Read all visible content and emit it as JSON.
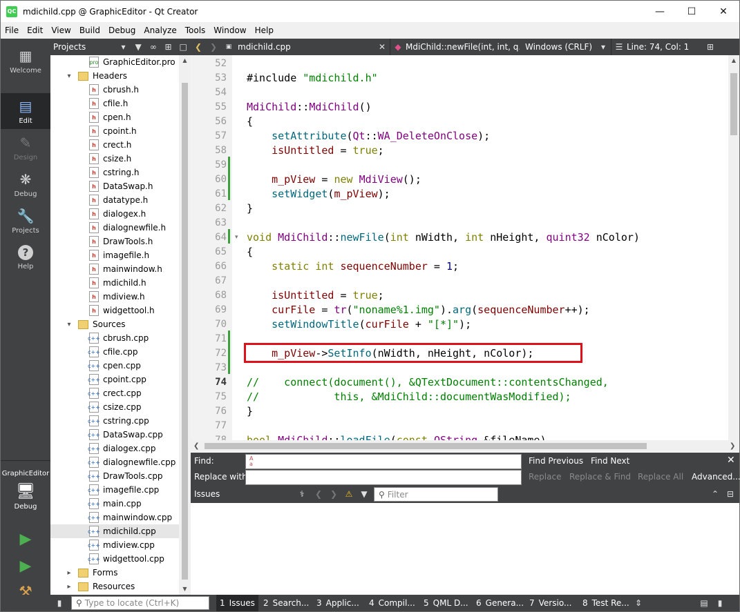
{
  "window": {
    "title": "mdichild.cpp @ GraphicEditor - Qt Creator",
    "app_icon_text": "QC",
    "controls": [
      "minimize-icon",
      "maximize-icon",
      "close-icon"
    ]
  },
  "menu": [
    "File",
    "Edit",
    "View",
    "Build",
    "Debug",
    "Analyze",
    "Tools",
    "Window",
    "Help"
  ],
  "modes": [
    {
      "label": "Welcome",
      "icon": "grid-icon"
    },
    {
      "label": "Edit",
      "icon": "document-icon",
      "active": true
    },
    {
      "label": "Design",
      "icon": "pencil-icon",
      "disabled": true
    },
    {
      "label": "Debug",
      "icon": "bug-icon"
    },
    {
      "label": "Projects",
      "icon": "wrench-icon"
    },
    {
      "label": "Help",
      "icon": "help-icon"
    }
  ],
  "kit": {
    "project": "GraphicEditor",
    "config": "Debug"
  },
  "projects_panel": {
    "title": "Projects"
  },
  "tree": [
    {
      "label": "GraphicEditor.pro",
      "type": "pro",
      "level": 2
    },
    {
      "label": "Headers",
      "type": "folder",
      "level": 1,
      "expanded": true
    },
    {
      "label": "cbrush.h",
      "type": "h",
      "level": 2
    },
    {
      "label": "cfile.h",
      "type": "h",
      "level": 2
    },
    {
      "label": "cpen.h",
      "type": "h",
      "level": 2
    },
    {
      "label": "cpoint.h",
      "type": "h",
      "level": 2
    },
    {
      "label": "crect.h",
      "type": "h",
      "level": 2
    },
    {
      "label": "csize.h",
      "type": "h",
      "level": 2
    },
    {
      "label": "cstring.h",
      "type": "h",
      "level": 2
    },
    {
      "label": "DataSwap.h",
      "type": "h",
      "level": 2
    },
    {
      "label": "datatype.h",
      "type": "h",
      "level": 2
    },
    {
      "label": "dialogex.h",
      "type": "h",
      "level": 2
    },
    {
      "label": "dialognewfile.h",
      "type": "h",
      "level": 2
    },
    {
      "label": "DrawTools.h",
      "type": "h",
      "level": 2
    },
    {
      "label": "imagefile.h",
      "type": "h",
      "level": 2
    },
    {
      "label": "mainwindow.h",
      "type": "h",
      "level": 2
    },
    {
      "label": "mdichild.h",
      "type": "h",
      "level": 2
    },
    {
      "label": "mdiview.h",
      "type": "h",
      "level": 2
    },
    {
      "label": "widgettool.h",
      "type": "h",
      "level": 2
    },
    {
      "label": "Sources",
      "type": "folder",
      "level": 1,
      "expanded": true
    },
    {
      "label": "cbrush.cpp",
      "type": "cpp",
      "level": 2
    },
    {
      "label": "cfile.cpp",
      "type": "cpp",
      "level": 2
    },
    {
      "label": "cpen.cpp",
      "type": "cpp",
      "level": 2
    },
    {
      "label": "cpoint.cpp",
      "type": "cpp",
      "level": 2
    },
    {
      "label": "crect.cpp",
      "type": "cpp",
      "level": 2
    },
    {
      "label": "csize.cpp",
      "type": "cpp",
      "level": 2
    },
    {
      "label": "cstring.cpp",
      "type": "cpp",
      "level": 2
    },
    {
      "label": "DataSwap.cpp",
      "type": "cpp",
      "level": 2
    },
    {
      "label": "dialogex.cpp",
      "type": "cpp",
      "level": 2
    },
    {
      "label": "dialognewfile.cpp",
      "type": "cpp",
      "level": 2
    },
    {
      "label": "DrawTools.cpp",
      "type": "cpp",
      "level": 2
    },
    {
      "label": "imagefile.cpp",
      "type": "cpp",
      "level": 2
    },
    {
      "label": "main.cpp",
      "type": "cpp",
      "level": 2
    },
    {
      "label": "mainwindow.cpp",
      "type": "cpp",
      "level": 2
    },
    {
      "label": "mdichild.cpp",
      "type": "cpp",
      "level": 2,
      "selected": true
    },
    {
      "label": "mdiview.cpp",
      "type": "cpp",
      "level": 2
    },
    {
      "label": "widgettool.cpp",
      "type": "cpp",
      "level": 2
    },
    {
      "label": "Forms",
      "type": "folder",
      "level": 1,
      "expanded": false
    },
    {
      "label": "Resources",
      "type": "folder",
      "level": 1,
      "expanded": false
    }
  ],
  "editor": {
    "file": "mdichild.cpp",
    "symbol": "MdiChild::newFile(int, int, q...",
    "encoding": "Windows (CRLF)",
    "position": "Line: 74, Col: 1",
    "current_line": 74,
    "lines": [
      {
        "n": 52,
        "code": ""
      },
      {
        "n": 53,
        "code": "#include \"mdichild.h\""
      },
      {
        "n": 54,
        "code": ""
      },
      {
        "n": 55,
        "code": "MdiChild::MdiChild()"
      },
      {
        "n": 56,
        "code": "{"
      },
      {
        "n": 57,
        "code": "    setAttribute(Qt::WA_DeleteOnClose);"
      },
      {
        "n": 58,
        "code": "    isUntitled = true;"
      },
      {
        "n": 59,
        "code": ""
      },
      {
        "n": 60,
        "code": "    m_pView = new MdiView();"
      },
      {
        "n": 61,
        "code": "    setWidget(m_pView);"
      },
      {
        "n": 62,
        "code": "}"
      },
      {
        "n": 63,
        "code": ""
      },
      {
        "n": 64,
        "code": "void MdiChild::newFile(int nWidth, int nHeight, quint32 nColor)"
      },
      {
        "n": 65,
        "code": "{"
      },
      {
        "n": 66,
        "code": "    static int sequenceNumber = 1;"
      },
      {
        "n": 67,
        "code": ""
      },
      {
        "n": 68,
        "code": "    isUntitled = true;"
      },
      {
        "n": 69,
        "code": "    curFile = tr(\"noname%1.img\").arg(sequenceNumber++);"
      },
      {
        "n": 70,
        "code": "    setWindowTitle(curFile + \"[*]\");"
      },
      {
        "n": 71,
        "code": ""
      },
      {
        "n": 72,
        "code": "    m_pView->SetInfo(nWidth, nHeight, nColor);"
      },
      {
        "n": 73,
        "code": ""
      },
      {
        "n": 74,
        "code": "//    connect(document(), &QTextDocument::contentsChanged,"
      },
      {
        "n": 75,
        "code": "//            this, &MdiChild::documentWasModified);"
      },
      {
        "n": 76,
        "code": "}"
      },
      {
        "n": 77,
        "code": ""
      },
      {
        "n": 78,
        "code": "bool MdiChild::loadFile(const QString &fileName)"
      }
    ],
    "highlight_color": "#e0101a",
    "highlighted_line": 72
  },
  "find": {
    "find_label": "Find:",
    "replace_label": "Replace with:",
    "find_value": "",
    "replace_value": "",
    "find_previous": "Find Previous",
    "find_next": "Find Next",
    "replace": "Replace",
    "replace_find": "Replace & Find",
    "replace_all": "Replace All",
    "advanced": "Advanced..."
  },
  "issues": {
    "title": "Issues",
    "filter_placeholder": "Filter"
  },
  "statusbar": {
    "locator_placeholder": "Type to locate (Ctrl+K)",
    "panes": [
      {
        "num": "1",
        "label": "Issues",
        "active": true
      },
      {
        "num": "2",
        "label": "Search..."
      },
      {
        "num": "3",
        "label": "Applic..."
      },
      {
        "num": "4",
        "label": "Compil..."
      },
      {
        "num": "5",
        "label": "QML D..."
      },
      {
        "num": "6",
        "label": "Genera..."
      },
      {
        "num": "7",
        "label": "Versio..."
      },
      {
        "num": "8",
        "label": "Test Re..."
      }
    ]
  }
}
